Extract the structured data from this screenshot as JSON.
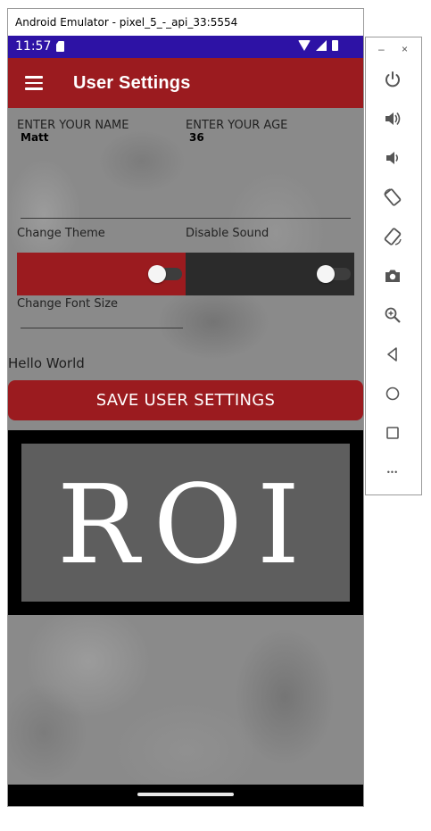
{
  "emulator": {
    "window_title": "Android Emulator - pixel_5_-_api_33:5554",
    "toolbar": {
      "minimize_label": "–",
      "close_label": "×",
      "more_label": "•••"
    }
  },
  "status_bar": {
    "time": "11:57"
  },
  "app_bar": {
    "title": "User Settings"
  },
  "form": {
    "name_label": "ENTER YOUR NAME",
    "name_value": "Matt",
    "age_label": "ENTER YOUR AGE",
    "age_value": "36",
    "theme_label": "Change Theme",
    "sound_label": "Disable Sound",
    "font_size_label": "Change Font Size",
    "preview_text": "Hello World",
    "save_button": "SAVE USER SETTINGS"
  },
  "logo": {
    "text": "ROI"
  },
  "colors": {
    "primary": "#9b1b1f",
    "status_bar": "#2d12a5",
    "dark_panel": "#2b2b2b"
  }
}
